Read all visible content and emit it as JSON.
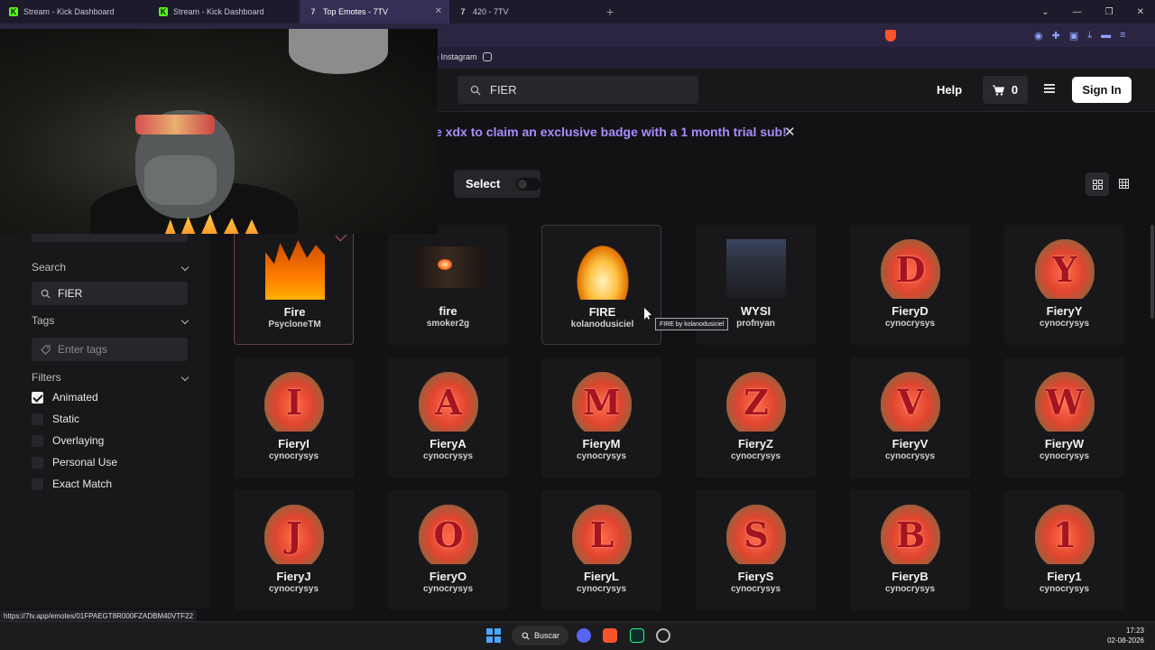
{
  "browser": {
    "tabs": [
      {
        "title": "Stream - Kick Dashboard",
        "favicon": "K",
        "active": false
      },
      {
        "title": "Stream - Kick Dashboard",
        "favicon": "K",
        "active": false
      },
      {
        "title": "Top Emotes - 7TV",
        "favicon": "7",
        "active": true
      },
      {
        "title": "420 - 7TV",
        "favicon": "7",
        "active": false
      }
    ],
    "new_tab": "+",
    "bookmark_instagram": "Instagram",
    "status_url": "https://7tv.app/emotes/01FPAEGT8R000FZADBM40VTF22"
  },
  "header": {
    "search_value": "FIER",
    "help": "Help",
    "cart_count": "0",
    "sign_in": "Sign In"
  },
  "banner": {
    "text": "e xdx to claim an exclusive badge with a 1 month trial sub!"
  },
  "toolbar": {
    "select_label": "Select"
  },
  "sidebar": {
    "search_label": "Search",
    "search_value": "FIER",
    "tags_label": "Tags",
    "tags_placeholder": "Enter tags",
    "filters_label": "Filters",
    "filters": [
      {
        "label": "Animated",
        "checked": true
      },
      {
        "label": "Static",
        "checked": false
      },
      {
        "label": "Overlaying",
        "checked": false
      },
      {
        "label": "Personal Use",
        "checked": false
      },
      {
        "label": "Exact Match",
        "checked": false
      }
    ]
  },
  "emotes": [
    {
      "name": "Fire",
      "author": "PsycloneTM"
    },
    {
      "name": "fire",
      "author": "smoker2g"
    },
    {
      "name": "FIRE",
      "author": "kolanodusiciel"
    },
    {
      "name": "WYSI",
      "author": "profnyan"
    },
    {
      "name": "FieryD",
      "author": "cynocrysys",
      "letter": "D"
    },
    {
      "name": "FieryY",
      "author": "cynocrysys",
      "letter": "Y"
    },
    {
      "name": "FieryI",
      "author": "cynocrysys",
      "letter": "I"
    },
    {
      "name": "FieryA",
      "author": "cynocrysys",
      "letter": "A"
    },
    {
      "name": "FieryM",
      "author": "cynocrysys",
      "letter": "M"
    },
    {
      "name": "FieryZ",
      "author": "cynocrysys",
      "letter": "Z"
    },
    {
      "name": "FieryV",
      "author": "cynocrysys",
      "letter": "V"
    },
    {
      "name": "FieryW",
      "author": "cynocrysys",
      "letter": "W"
    },
    {
      "name": "FieryJ",
      "author": "cynocrysys",
      "letter": "J"
    },
    {
      "name": "FieryO",
      "author": "cynocrysys",
      "letter": "O"
    },
    {
      "name": "FieryL",
      "author": "cynocrysys",
      "letter": "L"
    },
    {
      "name": "FieryS",
      "author": "cynocrysys",
      "letter": "S"
    },
    {
      "name": "FieryB",
      "author": "cynocrysys",
      "letter": "B"
    },
    {
      "name": "Fiery1",
      "author": "cynocrysys",
      "letter": "1"
    }
  ],
  "tooltip": "FIRE by kolanodusiciel",
  "taskbar": {
    "search": "Buscar",
    "time": "17:23",
    "date": "02-08-2026"
  },
  "colors": {
    "accent_banner": "#a98cff",
    "background": "#121214",
    "card": "#18181b"
  }
}
